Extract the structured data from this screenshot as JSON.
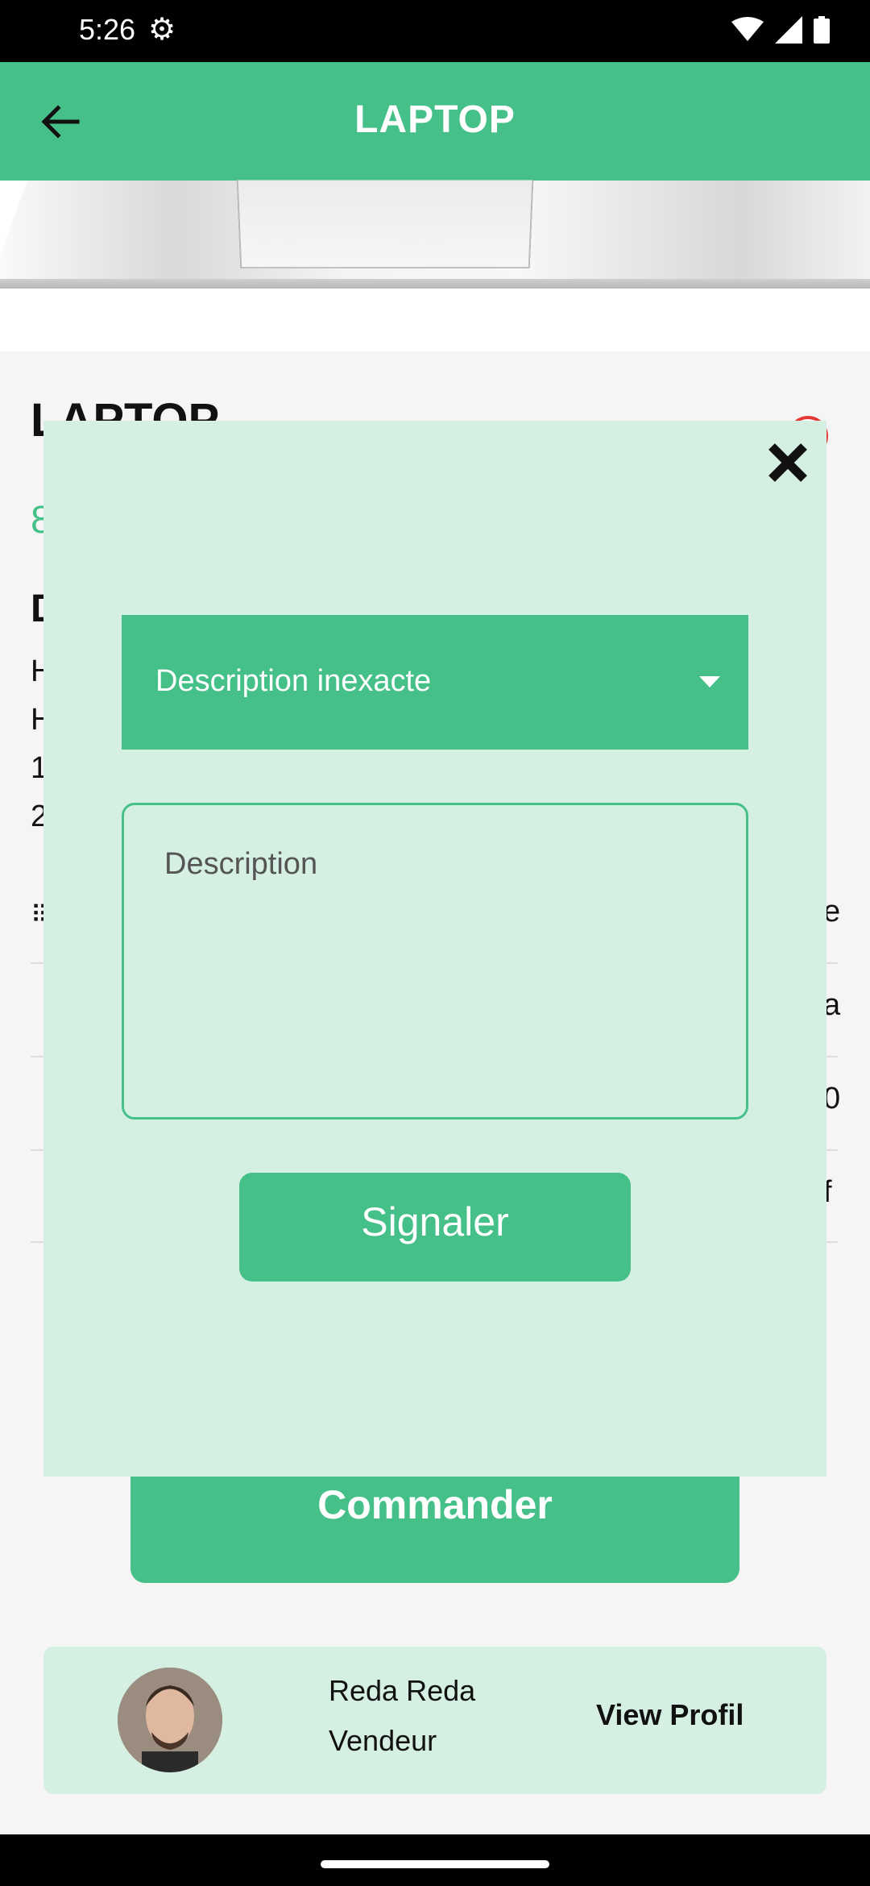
{
  "status_bar": {
    "time": "5:26"
  },
  "app_bar": {
    "title": "LAPTOP"
  },
  "background": {
    "product_title": "LAPTOP",
    "price_fragment": "8",
    "section_fragment": "D",
    "desc_fragments": [
      "H",
      "H",
      "1",
      "2"
    ],
    "row_fragments_right": [
      "e",
      "a",
      "0",
      "f"
    ],
    "order_button": "Commander"
  },
  "seller": {
    "name": "Reda Reda",
    "role": "Vendeur",
    "view_label": "View Profil"
  },
  "report_dialog": {
    "reason_selected": "Description inexacte",
    "description_placeholder": "Description",
    "submit_label": "Signaler"
  },
  "colors": {
    "accent": "#45c088",
    "dialog_bg": "#d5efe3"
  }
}
